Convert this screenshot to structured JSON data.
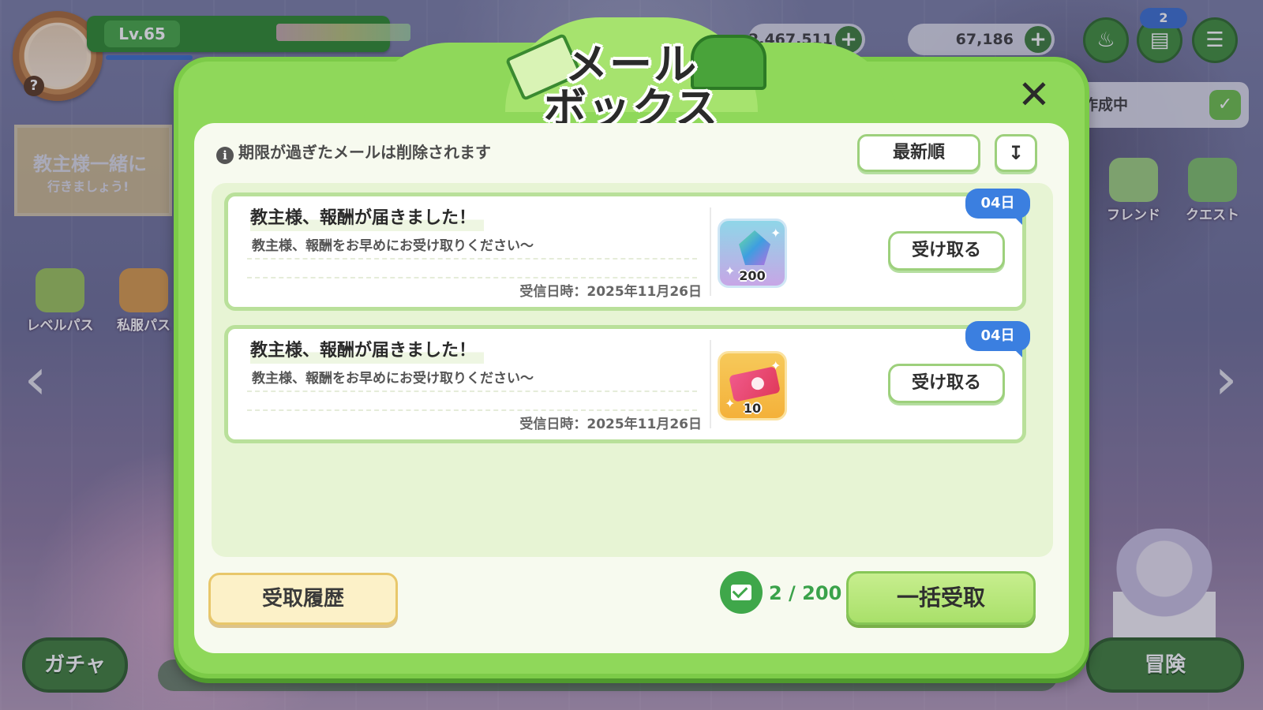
{
  "hud": {
    "level": "Lv.65",
    "currency1": "2,467,511",
    "currency2": "67,186",
    "notif_badge": "2",
    "quest_status": "作成中",
    "event_banner_title": "教主様一緒に",
    "event_banner_sub": "行きましょう!",
    "left_icons": [
      "レベルパス",
      "私服パス"
    ],
    "right_icons": [
      "フレンド",
      "クエスト"
    ],
    "bottom_tabs": {
      "gacha": "ガチャ",
      "adventure": "冒険"
    }
  },
  "mailbox": {
    "title_line1": "メール",
    "title_line2": "ボックス",
    "notice": "期限が過ぎたメールは削除されます",
    "sort_label": "最新順",
    "mails": [
      {
        "title": "教主様、報酬が届きました！",
        "body": "教主様、報酬をお早めにお受け取りください～",
        "date": "受信日時：2025年11月26日",
        "item": "crystal-icon",
        "item_count": "200",
        "days_left": "04日",
        "button": "受け取る"
      },
      {
        "title": "教主様、報酬が届きました！",
        "body": "教主様、報酬をお早めにお受け取りください～",
        "date": "受信日時：2025年11月26日",
        "item": "ticket-icon",
        "item_count": "10",
        "days_left": "04日",
        "button": "受け取る"
      }
    ],
    "history_button": "受取履歴",
    "mail_count": "2 / 200",
    "claim_all_button": "一括受取"
  },
  "colors": {
    "frame_green": "#7ccb48",
    "panel": "#f7faef",
    "accent_blue": "#3b7fe0",
    "count_green": "#3aa24a"
  }
}
